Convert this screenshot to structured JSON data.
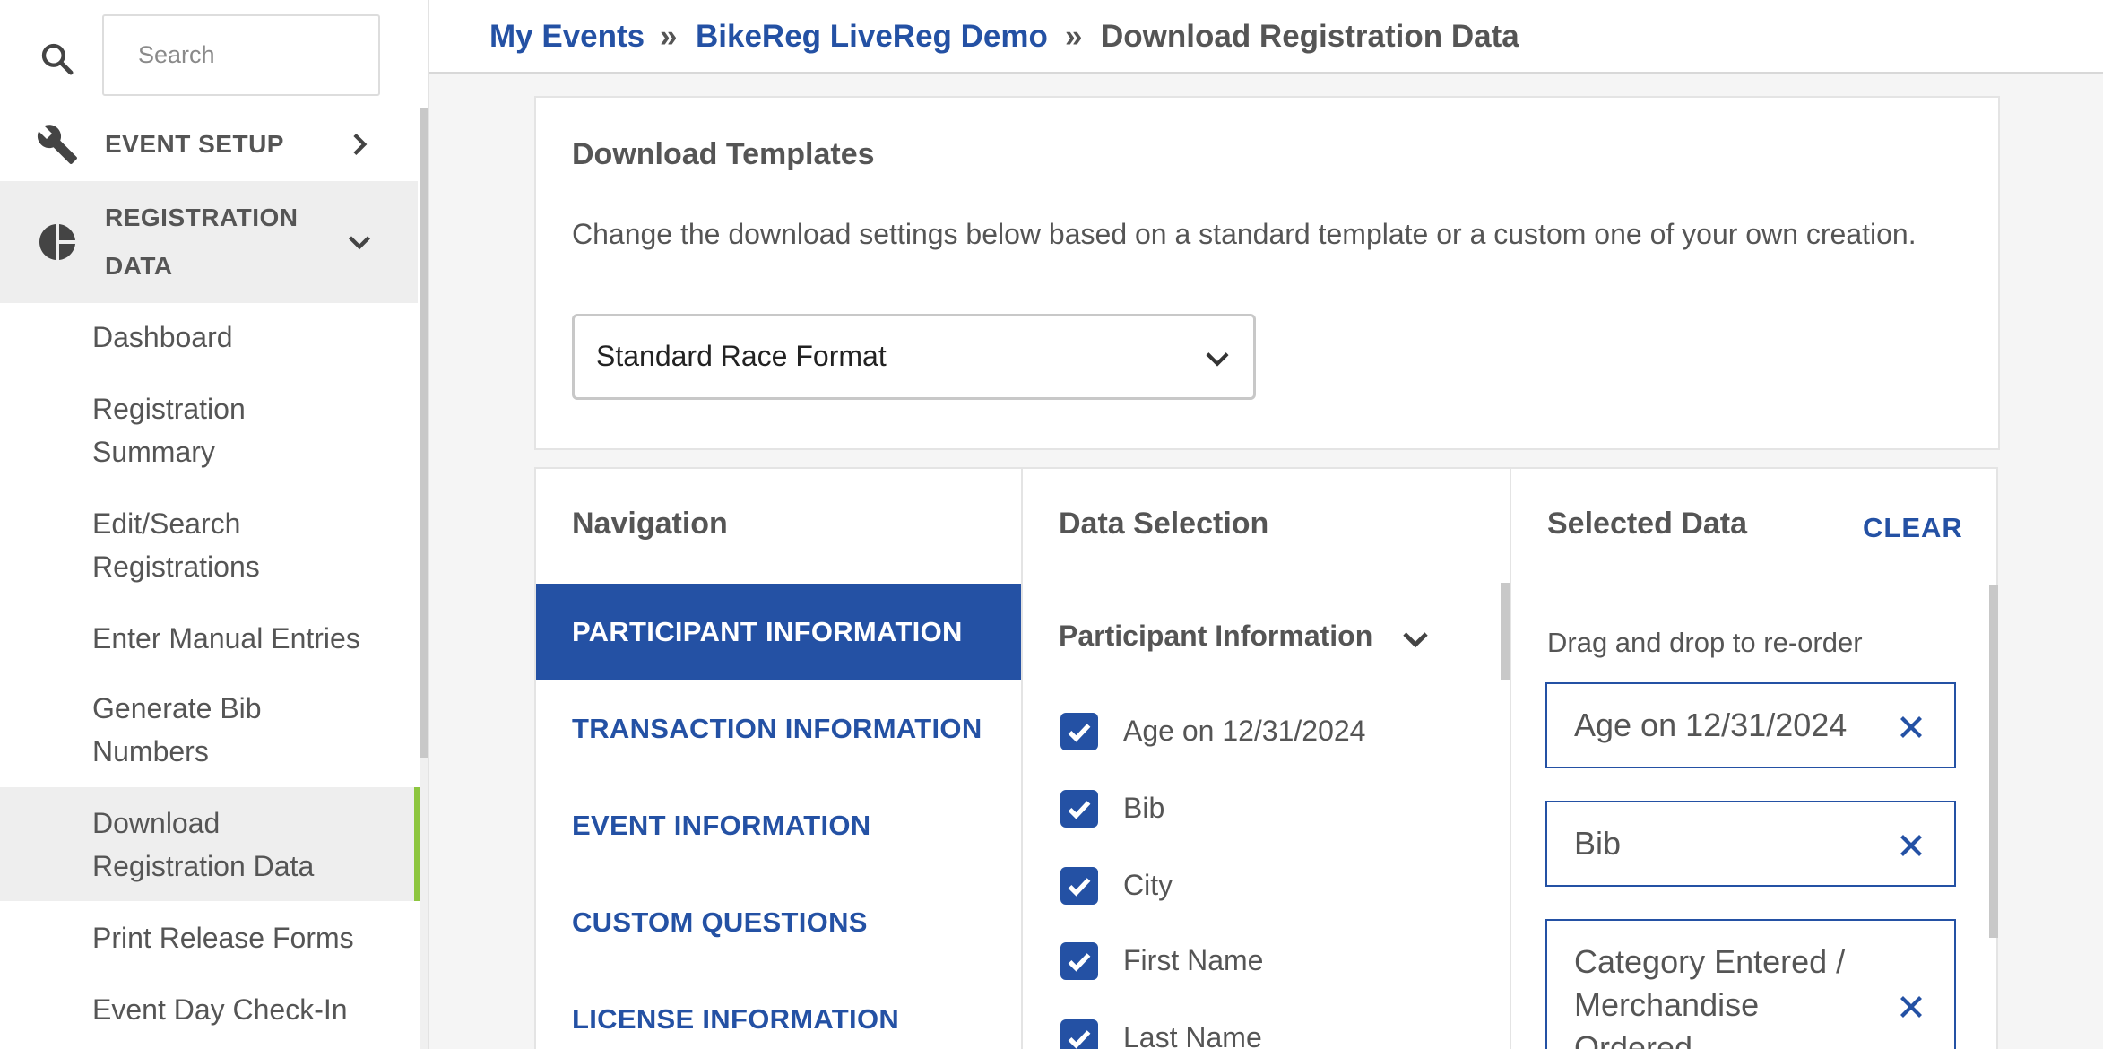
{
  "search": {
    "placeholder": "Search"
  },
  "sidebar": {
    "sections": [
      {
        "label": "EVENT SETUP",
        "icon": "wrench-icon",
        "state": "collapsed"
      },
      {
        "label_line1": "REGISTRATION",
        "label_line2": "DATA",
        "icon": "pie-chart-icon",
        "state": "expanded"
      }
    ],
    "items": [
      {
        "line1": "Dashboard",
        "line2": ""
      },
      {
        "line1": "Registration",
        "line2": "Summary"
      },
      {
        "line1": "Edit/Search",
        "line2": "Registrations"
      },
      {
        "line1": "Enter Manual Entries",
        "line2": ""
      },
      {
        "line1": "Generate Bib",
        "line2": "Numbers"
      },
      {
        "line1": "Download",
        "line2": "Registration Data"
      },
      {
        "line1": "Print Release Forms",
        "line2": ""
      },
      {
        "line1": "Event Day Check-In",
        "line2": ""
      }
    ],
    "active_item_index": 5,
    "active_color": "#8dc63f"
  },
  "breadcrumb": {
    "items": [
      "My Events",
      "BikeReg LiveReg Demo",
      "Download Registration Data"
    ],
    "separator": "»"
  },
  "templates": {
    "title": "Download Templates",
    "description": "Change the download settings below based on a standard template or a custom one of your own creation.",
    "selected": "Standard Race Format"
  },
  "navigation": {
    "title": "Navigation",
    "items": [
      "PARTICIPANT INFORMATION",
      "TRANSACTION INFORMATION",
      "EVENT INFORMATION",
      "CUSTOM QUESTIONS",
      "LICENSE INFORMATION"
    ],
    "active_index": 0
  },
  "data_selection": {
    "title": "Data Selection",
    "group": "Participant Information",
    "fields": [
      {
        "label": "Age on 12/31/2024",
        "checked": true
      },
      {
        "label": "Bib",
        "checked": true
      },
      {
        "label": "City",
        "checked": true
      },
      {
        "label": "First Name",
        "checked": true
      },
      {
        "label": "Last Name",
        "checked": true
      }
    ]
  },
  "selected_data": {
    "title": "Selected Data",
    "clear_label": "CLEAR",
    "hint": "Drag and drop to re-order",
    "chips": [
      {
        "line1": "Age on 12/31/2024",
        "line2": "",
        "line3": ""
      },
      {
        "line1": "Bib",
        "line2": "",
        "line3": ""
      },
      {
        "line1": "Category Entered /",
        "line2": "Merchandise",
        "line3": "Ordered"
      }
    ]
  },
  "colors": {
    "primary": "#2451a4",
    "accent": "#8dc63f",
    "text": "#555555"
  }
}
